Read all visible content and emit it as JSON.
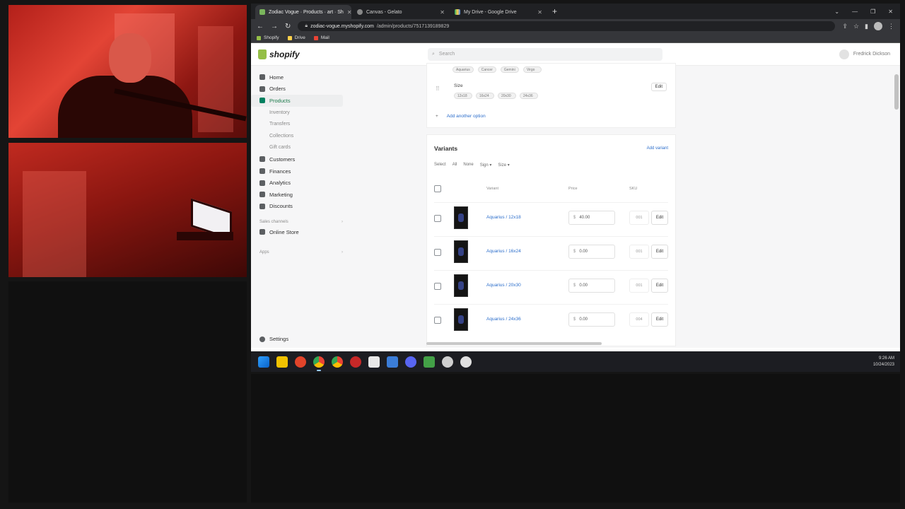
{
  "browser": {
    "tabs": [
      {
        "label": "Zodiac Vogue · Products · art · Sh",
        "active": true
      },
      {
        "label": "Canvas - Gelato",
        "active": false
      },
      {
        "label": "My Drive - Google Drive",
        "active": false
      }
    ],
    "url_host": "zodiac-vogue.myshopify.com",
    "url_path": "/admin/products/7517139189829",
    "bookmarks": [
      "Shopify",
      "Drive",
      "Mail"
    ]
  },
  "shopify": {
    "logo": "shopify",
    "search_placeholder": "Search",
    "user_name": "Fredrick Dickson",
    "sidebar": {
      "items": [
        "Home",
        "Orders",
        "Products"
      ],
      "product_subitems": [
        "Inventory",
        "Transfers",
        "Collections",
        "Gift cards"
      ],
      "items2": [
        "Customers",
        "Finances",
        "Analytics",
        "Marketing",
        "Discounts"
      ],
      "sales_channels_label": "Sales channels",
      "online_store": "Online Store",
      "apps_label": "Apps",
      "settings": "Settings"
    },
    "options": {
      "top_chips": [
        "Aquarius",
        "Cancer",
        "Gemini",
        "Virgo"
      ],
      "size_label": "Size",
      "size_values": [
        "12x18",
        "16x24",
        "20x30",
        "24x36"
      ],
      "edit_label": "Edit",
      "add_option": "Add another option"
    },
    "variants": {
      "title": "Variants",
      "add_variant": "Add variant",
      "filters": [
        "Select",
        "All",
        "None",
        "Sign ▾",
        "Size ▾"
      ],
      "columns": {
        "variant": "Variant",
        "price": "Price",
        "sku": "SKU"
      },
      "currency": "$",
      "edit_label": "Edit",
      "rows": [
        {
          "name": "Aquarius / 12x18",
          "price": "40.00",
          "sku": "001"
        },
        {
          "name": "Aquarius / 16x24",
          "price": "0.00",
          "sku": "001"
        },
        {
          "name": "Aquarius / 20x30",
          "price": "0.00",
          "sku": "001"
        },
        {
          "name": "Aquarius / 24x36",
          "price": "0.00",
          "sku": "004"
        }
      ]
    }
  },
  "taskbar": {
    "time": "9:26 AM",
    "date": "10/24/2023"
  }
}
